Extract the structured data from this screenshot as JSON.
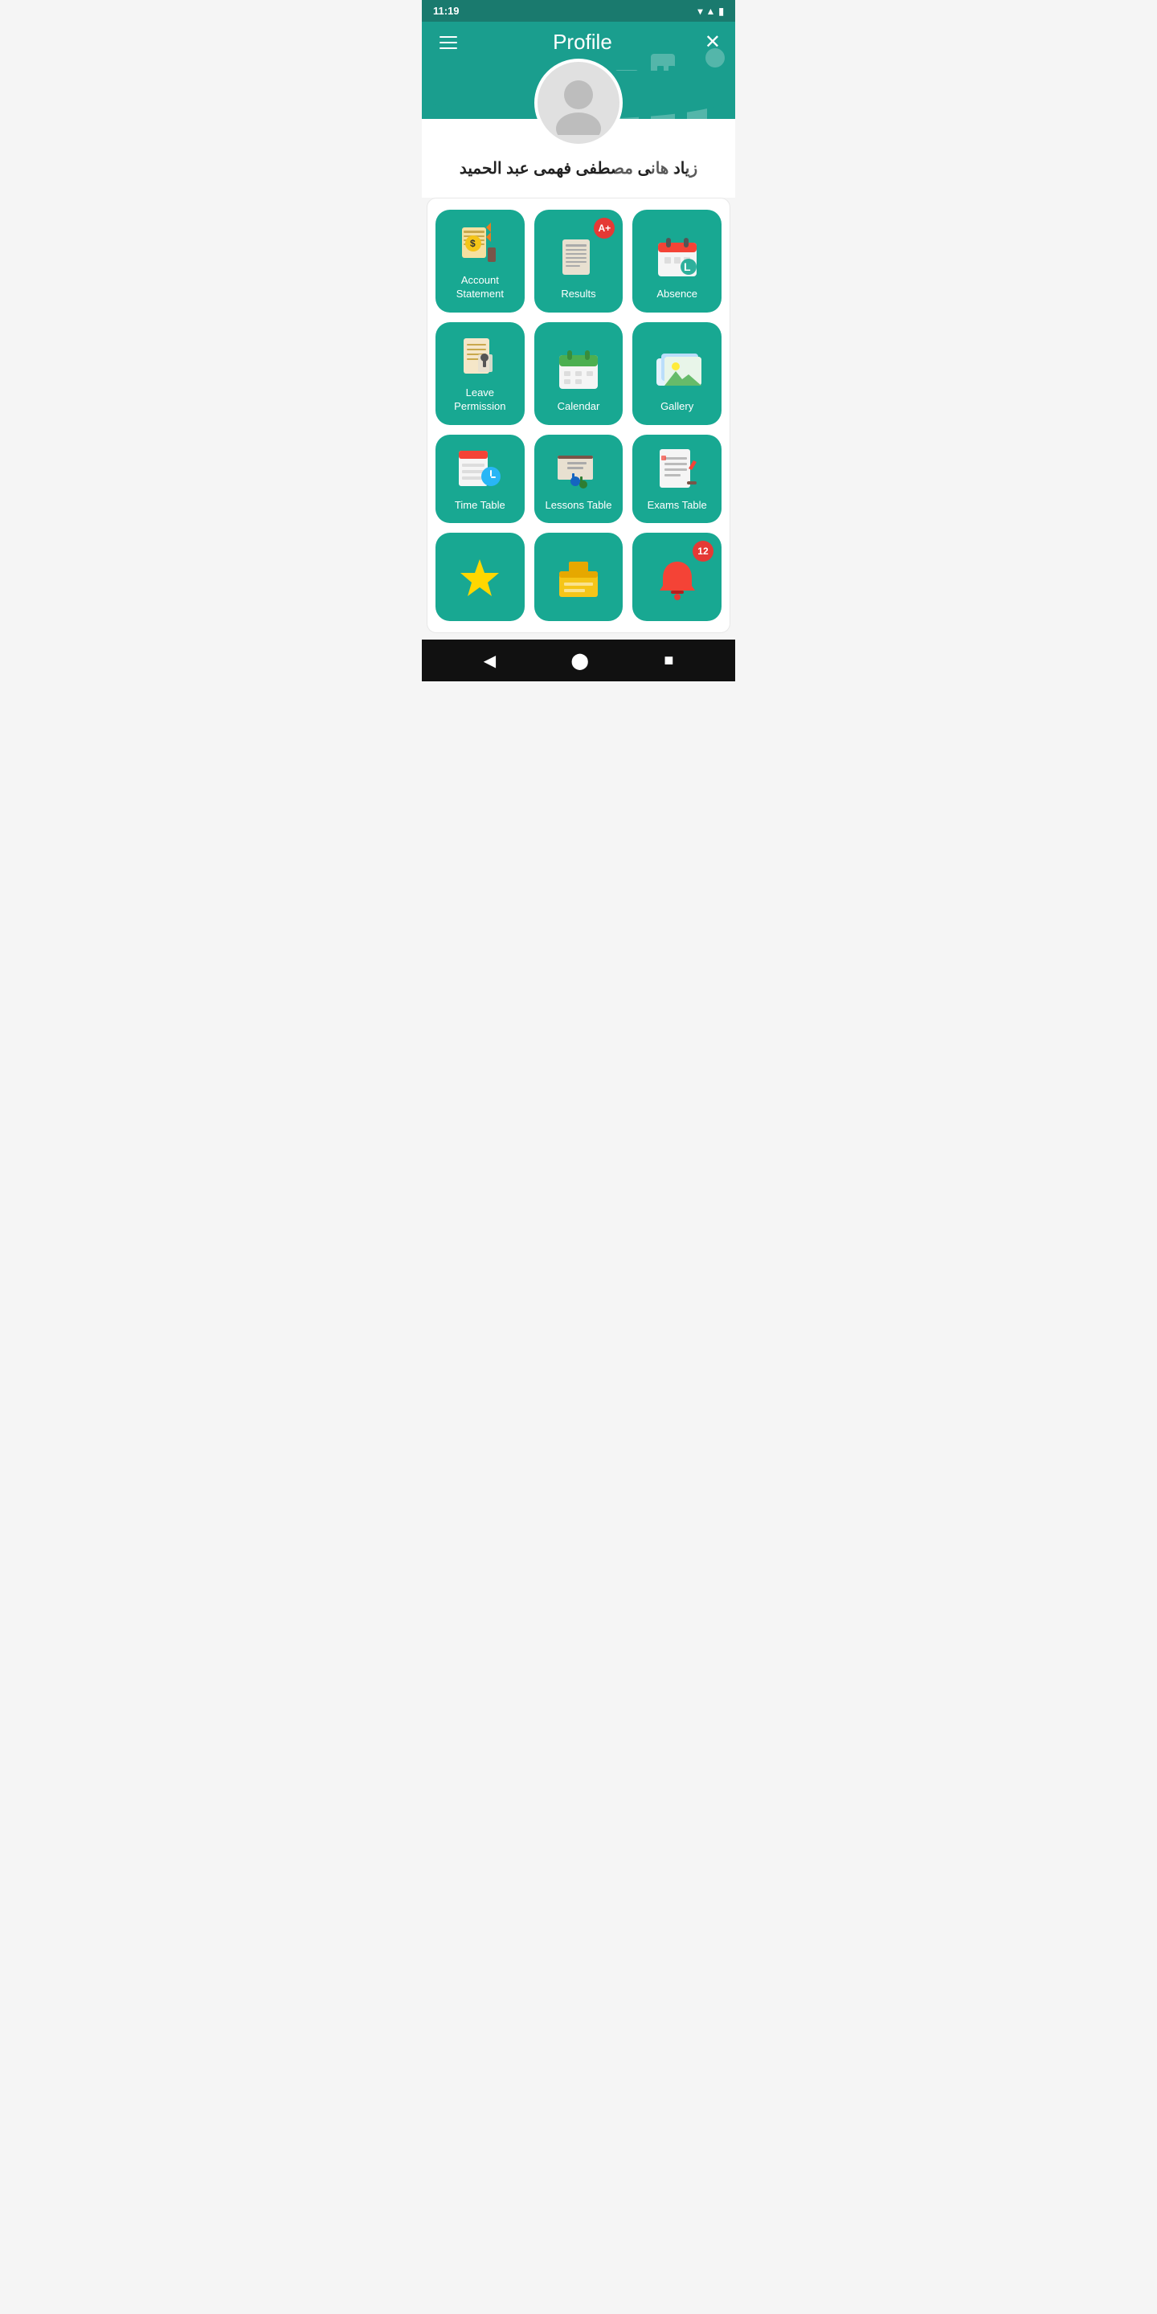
{
  "statusBar": {
    "time": "11:19",
    "icons": [
      "wifi",
      "signal",
      "battery"
    ]
  },
  "header": {
    "menuLabel": "menu",
    "title": "Profile",
    "closeLabel": "close"
  },
  "profile": {
    "userName": "زياد هانى مصطفى فهمى عبد الحميد"
  },
  "grid": {
    "items": [
      {
        "id": "account-statement",
        "label": "Account\nStatement",
        "badge": null,
        "emoji": "💰"
      },
      {
        "id": "results",
        "label": "Results",
        "badge": "A+",
        "emoji": "📋"
      },
      {
        "id": "absence",
        "label": "Absence",
        "badge": null,
        "emoji": "📅"
      },
      {
        "id": "leave-permission",
        "label": "Leave\nPermission",
        "badge": null,
        "emoji": "📄"
      },
      {
        "id": "calendar",
        "label": "Calendar",
        "badge": null,
        "emoji": "🗓️"
      },
      {
        "id": "gallery",
        "label": "Gallery",
        "badge": null,
        "emoji": "🖼️"
      },
      {
        "id": "time-table",
        "label": "Time Table",
        "badge": null,
        "emoji": "⏰"
      },
      {
        "id": "lessons-table",
        "label": "Lessons Table",
        "badge": null,
        "emoji": "👨‍🏫"
      },
      {
        "id": "exams-table",
        "label": "Exams Table",
        "badge": null,
        "emoji": "📝"
      },
      {
        "id": "item-10",
        "label": "",
        "badge": null,
        "emoji": "🏆"
      },
      {
        "id": "item-11",
        "label": "",
        "badge": null,
        "emoji": "📂"
      },
      {
        "id": "item-12",
        "label": "",
        "badge": "12",
        "emoji": "🔔"
      }
    ]
  },
  "bottomNav": {
    "back": "◀",
    "home": "⬤",
    "square": "■"
  }
}
